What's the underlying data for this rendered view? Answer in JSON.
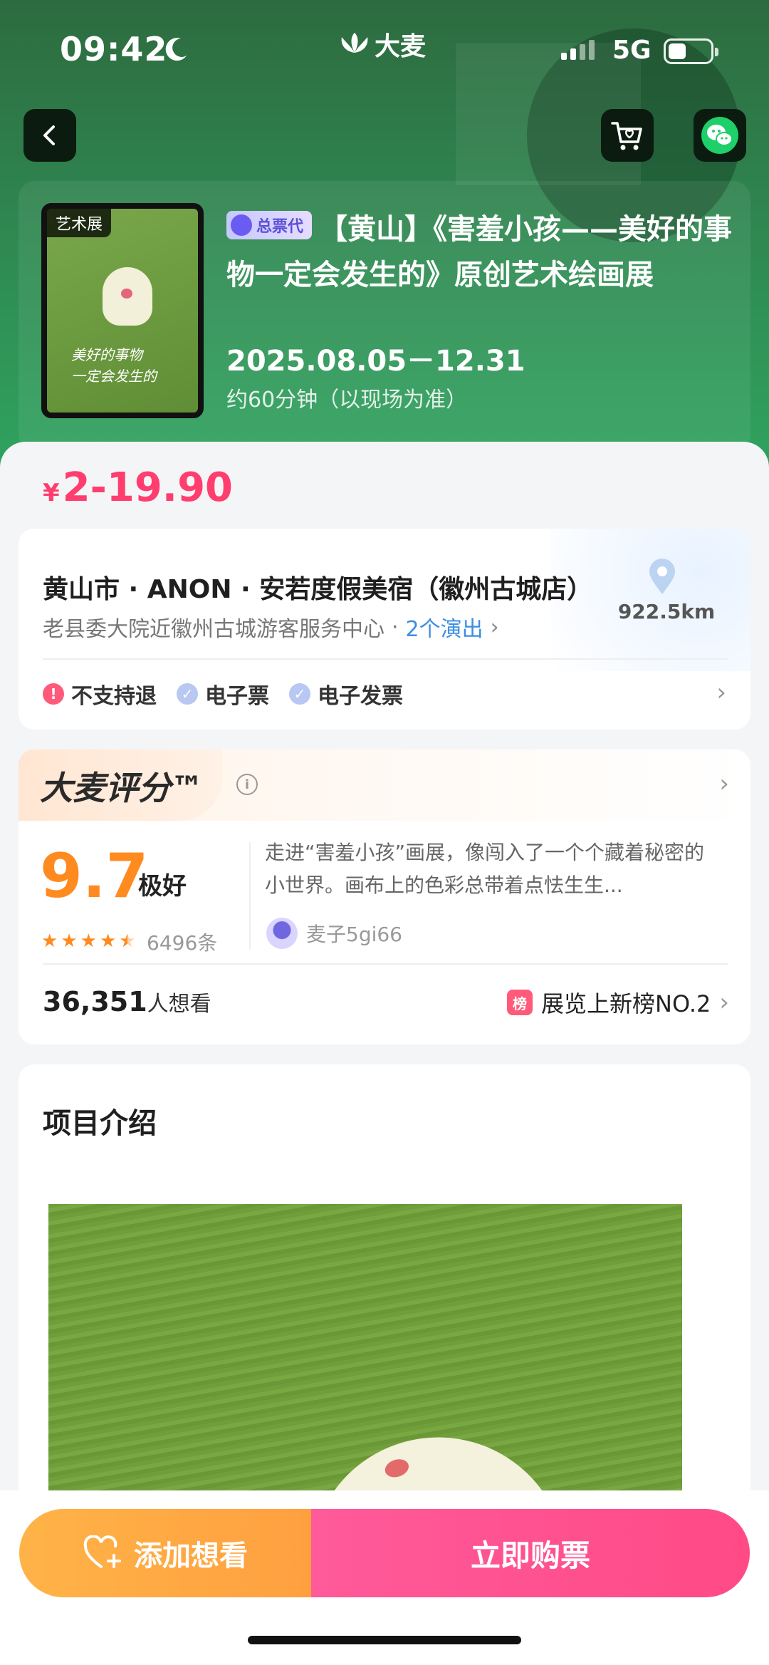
{
  "status": {
    "time": "09:42",
    "network": "5G",
    "brand": "大麦",
    "battery_level": 0.35
  },
  "event": {
    "category": "艺术展",
    "badge": "总票代",
    "title": "【黄山】《害羞小孩——美好的事物一定会发生的》原创艺术绘画展",
    "date": "2025.08.05－12.31",
    "duration": "约60分钟（以现场为准）",
    "poster_text_line1": "美好的事物",
    "poster_text_line2": "一定会发生的"
  },
  "price": {
    "currency": "¥",
    "range": "2-19.90"
  },
  "venue": {
    "name": "黄山市 · ANON · 安若度假美宿（徽州古城店）",
    "address": "老县委大院近徽州古城游客服务中心",
    "separator": "·",
    "shows": "2个演出",
    "distance": "922.5km",
    "tags": [
      "不支持退",
      "电子票",
      "电子发票"
    ]
  },
  "rating": {
    "logo": "大麦评分™",
    "score": "9.7",
    "score_word": "极好",
    "stars": 4.5,
    "count": "6496条",
    "review": "走进“害羞小孩”画展，像闯入了一个个藏着秘密的小世界。画布上的色彩总带着点怯生生...",
    "reviewer": "麦子5gi66",
    "want_count": "36,351",
    "want_label": "人想看",
    "rank_icon": "榜",
    "rank_text": "展览上新榜NO.2"
  },
  "intro": {
    "title": "项目介绍"
  },
  "actions": {
    "want": "添加想看",
    "buy": "立即购票"
  },
  "colors": {
    "accent": "#ff3d6e",
    "hero_green": "#2f8750",
    "rating_orange": "#ff8a1f",
    "link_blue": "#3b8ee3"
  }
}
